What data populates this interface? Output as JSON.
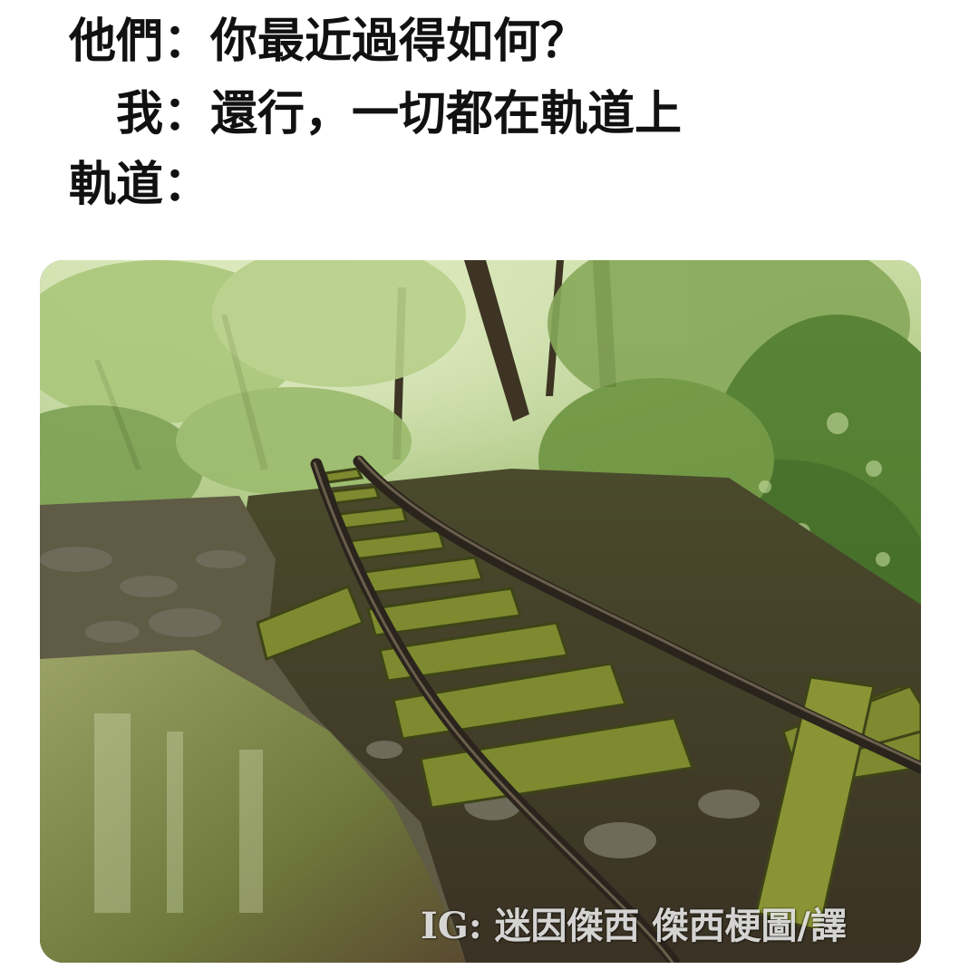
{
  "dialogue": [
    {
      "speaker": "他們",
      "colon": "：",
      "text": "你最近過得如何？"
    },
    {
      "speaker": "我",
      "colon": "：",
      "text": "還行，一切都在軌道上"
    },
    {
      "speaker": "軌道",
      "colon": "：",
      "text": ""
    }
  ],
  "photo": {
    "watermark": "IG: 迷因傑西 傑西梗圖/譯",
    "colors": {
      "foliage_light": "#9fbf72",
      "foliage_dark": "#3f5a22",
      "moss": "#7d8a2f",
      "rail": "#2a241d",
      "water": "#7f8a4a"
    }
  }
}
